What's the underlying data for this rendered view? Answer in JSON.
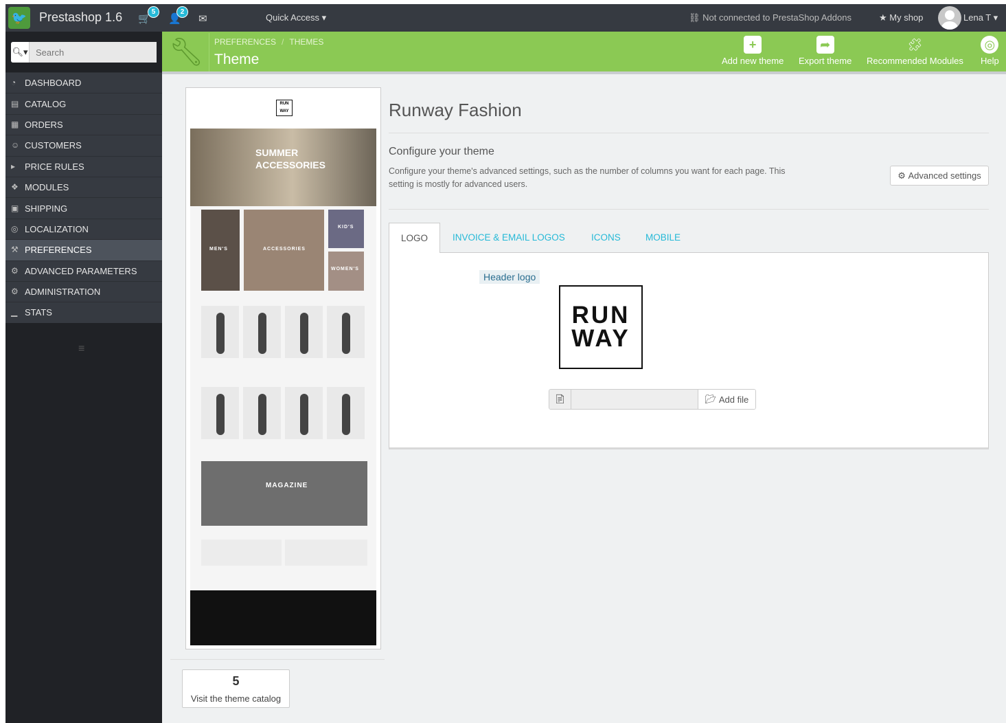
{
  "topbar": {
    "app_title": "Prestashop 1.6",
    "orders_count": "5",
    "customers_count": "2",
    "quick_access": "Quick Access ▾",
    "addons_status": "Not connected to PrestaShop Addons",
    "my_shop": "My shop",
    "user": "Lena T ▾"
  },
  "sidebar": {
    "search_placeholder": "Search",
    "items": [
      {
        "label": "DASHBOARD",
        "icon": "dashboard-icon"
      },
      {
        "label": "CATALOG",
        "icon": "catalog-icon"
      },
      {
        "label": "ORDERS",
        "icon": "orders-icon"
      },
      {
        "label": "CUSTOMERS",
        "icon": "customers-icon"
      },
      {
        "label": "PRICE RULES",
        "icon": "price-rules-icon"
      },
      {
        "label": "MODULES",
        "icon": "modules-icon"
      },
      {
        "label": "SHIPPING",
        "icon": "shipping-icon"
      },
      {
        "label": "LOCALIZATION",
        "icon": "localization-icon"
      },
      {
        "label": "PREFERENCES",
        "icon": "preferences-icon"
      },
      {
        "label": "ADVANCED PARAMETERS",
        "icon": "advanced-parameters-icon"
      },
      {
        "label": "ADMINISTRATION",
        "icon": "administration-icon"
      },
      {
        "label": "STATS",
        "icon": "stats-icon"
      }
    ],
    "active_index": 8
  },
  "header": {
    "breadcrumb_1": "PREFERENCES",
    "breadcrumb_sep": "/",
    "breadcrumb_2": "THEMES",
    "title": "Theme",
    "toolbar": {
      "add_theme": "Add new theme",
      "export_theme": "Export theme",
      "recommended_modules": "Recommended Modules",
      "help": "Help"
    }
  },
  "preview": {
    "logo_text_1": "RUN",
    "logo_text_2": "WAY",
    "hero_line_1": "SUMMER",
    "hero_line_2": "ACCESSORIES",
    "cat_men": "MEN'S",
    "cat_accessories": "ACCESSORIES",
    "cat_kids": "KID'S",
    "cat_women": "WOMEN'S",
    "magazine": "MAGAZINE",
    "visit_catalog": "Visit the theme catalog"
  },
  "main": {
    "theme_name": "Runway Fashion",
    "configure_title": "Configure your theme",
    "configure_desc": "Configure your theme's advanced settings, such as the number of columns you want for each page. This setting is mostly for advanced users.",
    "advanced_settings": "Advanced settings",
    "tabs": [
      "LOGO",
      "INVOICE & EMAIL LOGOS",
      "ICONS",
      "MOBILE"
    ],
    "header_logo_label": "Header logo",
    "logo_text_1": "RUN",
    "logo_text_2": "WAY",
    "add_file": "Add file"
  },
  "colors": {
    "header_green": "#8bc954",
    "topbar_dark": "#363a41",
    "sidebar_dark": "#202226",
    "link_blue": "#25b9d7"
  }
}
